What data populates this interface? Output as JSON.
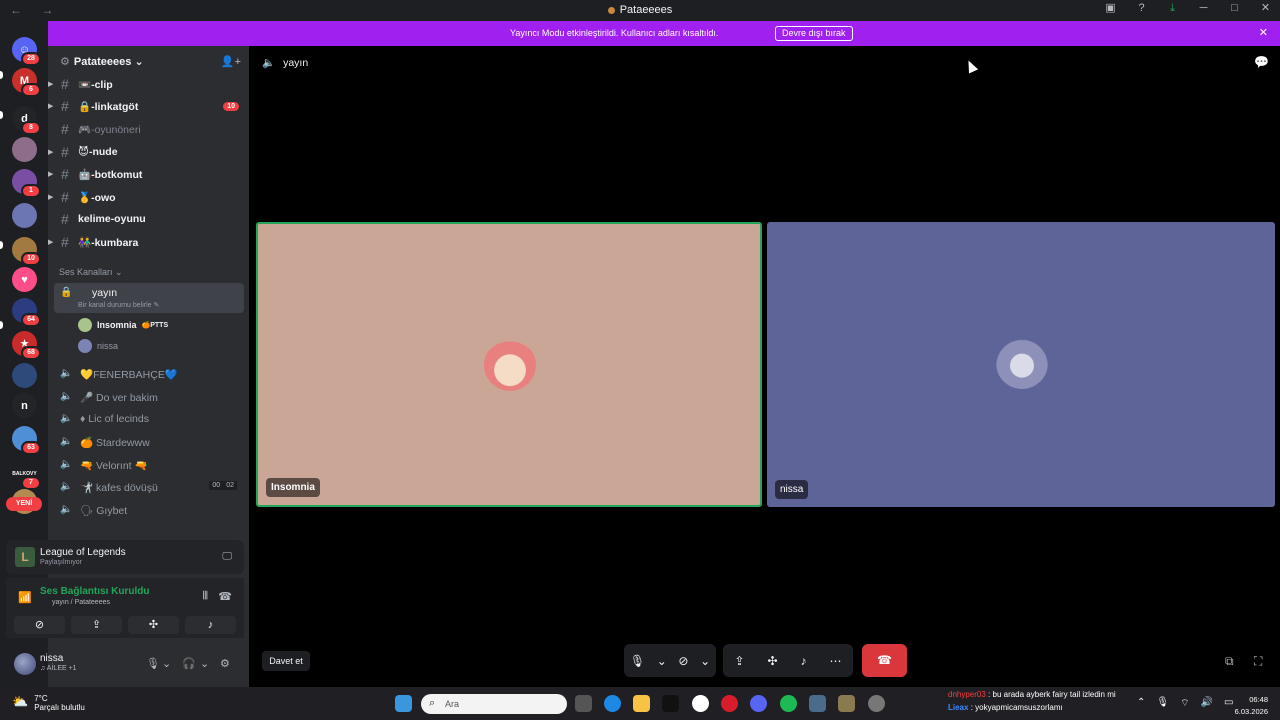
{
  "window": {
    "title": "Pataeeees",
    "nav_icons": "← →",
    "right_icons": [
      "screen-icon",
      "help-icon",
      "download-icon",
      "minimize-icon",
      "maximize-icon",
      "close-icon"
    ]
  },
  "rail": {
    "servers": [
      {
        "name": "home",
        "badge": "28",
        "color": "#5865f2",
        "glyph": "☺"
      },
      {
        "name": "server-m",
        "badge": "6",
        "color": "#c9302c",
        "glyph": "M"
      },
      {
        "name": "server-d",
        "badge": "8",
        "color": "#232428",
        "glyph": "d"
      },
      {
        "name": "server-4",
        "badge": "",
        "color": "#8e6d8a",
        "glyph": ""
      },
      {
        "name": "server-5",
        "badge": "1",
        "color": "#7a4fa3",
        "glyph": ""
      },
      {
        "name": "server-6",
        "badge": "",
        "color": "#6b76b3",
        "glyph": ""
      },
      {
        "name": "server-7",
        "badge": "10",
        "color": "#a07a40",
        "glyph": ""
      },
      {
        "name": "server-8",
        "badge": "",
        "color": "#ff4d8a",
        "glyph": "♥"
      },
      {
        "name": "server-9",
        "badge": "64",
        "color": "#2c3c80",
        "glyph": ""
      },
      {
        "name": "server-10",
        "badge": "68",
        "color": "#c92a2a",
        "glyph": "★"
      },
      {
        "name": "server-11",
        "badge": "",
        "color": "#2d4a7a",
        "glyph": ""
      },
      {
        "name": "server-n",
        "badge": "",
        "color": "#232428",
        "glyph": "n"
      },
      {
        "name": "server-13",
        "badge": "63",
        "color": "#4f8fd6",
        "glyph": ""
      },
      {
        "name": "server-14",
        "badge": "7",
        "color": "#1e1f22",
        "glyph": "BALKOVY"
      },
      {
        "name": "server-15",
        "badge": "",
        "color": "#b38b4e",
        "glyph": ""
      }
    ],
    "new_label": "YENİ"
  },
  "guild": {
    "name": "Patateeees",
    "chevron": "⌄",
    "text_channels": [
      {
        "icon": "📼",
        "name": "-clip",
        "style": "bold",
        "arrow": true,
        "count": ""
      },
      {
        "icon": "🔒",
        "name": "-linkatgöt",
        "style": "bold",
        "arrow": true,
        "count": "10"
      },
      {
        "icon": "🎮",
        "name": "-oyunöneri",
        "style": "dim",
        "arrow": false,
        "count": ""
      },
      {
        "icon": "😈",
        "name": "-nude",
        "style": "bold",
        "arrow": true,
        "count": ""
      },
      {
        "icon": "🤖",
        "name": "-botkomut",
        "style": "bold",
        "arrow": true,
        "count": ""
      },
      {
        "icon": "🥇",
        "name": "-owo",
        "style": "bold",
        "arrow": true,
        "count": ""
      },
      {
        "icon": "",
        "name": "kelime-oyunu",
        "style": "bold",
        "arrow": false,
        "count": ""
      },
      {
        "icon": "👫",
        "name": "-kumbara",
        "style": "bold",
        "arrow": true,
        "count": ""
      }
    ],
    "voice_section": "Ses Kanalları ⌄",
    "active_voice": {
      "name": "yayın",
      "status_hint": "Bir kanal durumu belirle ✎"
    },
    "voice_users": [
      {
        "name": "Insomnia",
        "tag": "🍊PTTS",
        "bold": true,
        "color": "#a8c48a"
      },
      {
        "name": "nissa",
        "tag": "",
        "bold": false,
        "color": "#7c84b5"
      }
    ],
    "voice_channels": [
      {
        "name": "💛FENERBAHÇE💙",
        "cap": []
      },
      {
        "name": "🎤 Do ver bakim",
        "cap": []
      },
      {
        "name": "♦ Lic of lecinds",
        "cap": []
      },
      {
        "name": "🍊 Stardewww",
        "cap": []
      },
      {
        "name": "🔫 Velorınt 🔫",
        "cap": []
      },
      {
        "name": "🤺 kafes dövüşü",
        "cap": [
          "00",
          "02"
        ]
      },
      {
        "name": "🗣 Gıybet",
        "cap": []
      }
    ]
  },
  "activity": {
    "game": "League of Legends",
    "status": "Paylaşılmıyor",
    "icon": "L"
  },
  "voice_panel": {
    "title": "Ses Bağlantısı Kuruldu",
    "subtitle": "yayın / Patateeees"
  },
  "user": {
    "name": "nissa",
    "status": "♫ AİLEE +1"
  },
  "banner": {
    "message": "Yayıncı Modu etkinleştirildi. Kullanıcı adları kısaltıldı.",
    "button": "Devre dışı bırak"
  },
  "main": {
    "channel": "yayın",
    "tiles": [
      {
        "name": "Insomnia"
      },
      {
        "name": "nissa"
      }
    ],
    "invite": "Davet et"
  },
  "taskbar": {
    "weather_temp": "7°C",
    "weather_desc": "Parçalı bulutlu",
    "search_placeholder": "Ara",
    "chat_line1_user": "dnhyper03",
    "chat_line1_text": ": bu arada ayberk fairy tail izledin mi",
    "chat_line2_user": "Lieax",
    "chat_line2_text": ": yokyapmicamsuszorlamı",
    "time": "06:48",
    "date": "6.03.2026"
  }
}
